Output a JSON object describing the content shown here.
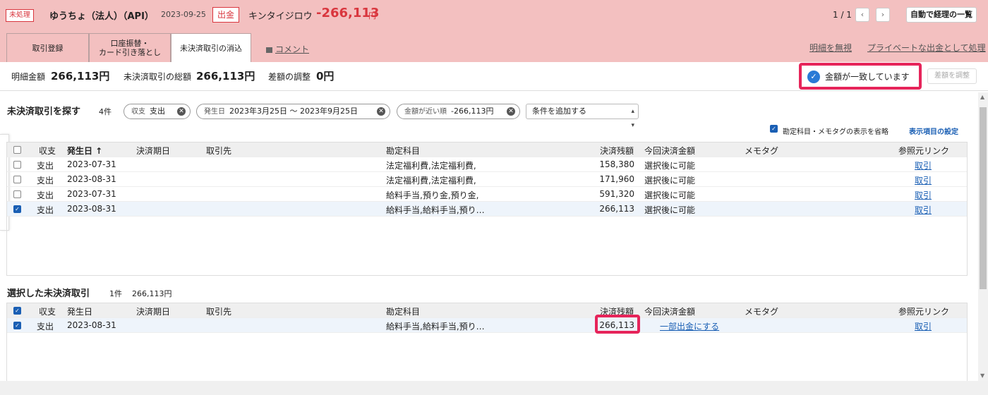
{
  "header": {
    "status_badge": "未処理",
    "account": "ゆうちょ（法人）（API）",
    "date": "2023-09-25",
    "direction": "出金",
    "payee": "キンタイジロウ",
    "amount": "-266,113",
    "amount_unit": "円",
    "pager": "1 / 1",
    "prev_icon": "‹",
    "next_icon": "›",
    "auto_list_label": "自動で経理の一覧"
  },
  "tabs": [
    {
      "label": "取引登録"
    },
    {
      "label": "口座振替・\nカード引き落とし"
    },
    {
      "label": "未決済取引の消込"
    }
  ],
  "comment_label": "コメント",
  "ignore_link": "明細を無視",
  "private_link": "プライベートな出金として処理",
  "summary": {
    "detail_label": "明細金額",
    "detail_value": "266,113円",
    "unsettled_label": "未決済取引の総額",
    "unsettled_value": "266,113円",
    "diff_label": "差額の調整",
    "diff_value": "0円",
    "match_text": "金額が一致しています",
    "adjust_button": "差額を調整"
  },
  "search": {
    "title": "未決済取引を探す",
    "count": "4件",
    "chips": [
      {
        "label": "収支",
        "value": "支出"
      },
      {
        "label": "発生日",
        "value": "2023年3月25日 〜 2023年9月25日"
      },
      {
        "label": "金額が近い順",
        "value": "-266,113円"
      }
    ],
    "add_condition": "条件を追加する",
    "omit_label": "勘定科目・メモタグの表示を省略",
    "display_settings": "表示項目の設定"
  },
  "columns": {
    "type": "収支",
    "date": "発生日",
    "date_sorted": "発生日 ↑",
    "due": "決済期日",
    "partner": "取引先",
    "account": "勘定科目",
    "balance": "決済残額",
    "this_amount": "今回決済金額",
    "memo": "メモタグ",
    "ref": "参照元リンク"
  },
  "results": [
    {
      "type": "支出",
      "date": "2023-07-31",
      "account": "法定福利費,法定福利費,",
      "balance": "158,380",
      "this": "選択後に可能",
      "ref": "取引",
      "checked": false
    },
    {
      "type": "支出",
      "date": "2023-08-31",
      "account": "法定福利費,法定福利費,",
      "balance": "171,960",
      "this": "選択後に可能",
      "ref": "取引",
      "checked": false
    },
    {
      "type": "支出",
      "date": "2023-07-31",
      "account": "給料手当,預り金,預り金,",
      "balance": "591,320",
      "this": "選択後に可能",
      "ref": "取引",
      "checked": false
    },
    {
      "type": "支出",
      "date": "2023-08-31",
      "account": "給料手当,給料手当,預り…",
      "balance": "266,113",
      "this": "選択後に可能",
      "ref": "取引",
      "checked": true
    }
  ],
  "selected": {
    "title": "選択した未決済取引",
    "count": "1件",
    "total": "266,113円",
    "rows": [
      {
        "type": "支出",
        "date": "2023-08-31",
        "account": "給料手当,給料手当,預り…",
        "balance": "266,113",
        "this": "一部出金にする",
        "ref": "取引"
      }
    ]
  }
}
